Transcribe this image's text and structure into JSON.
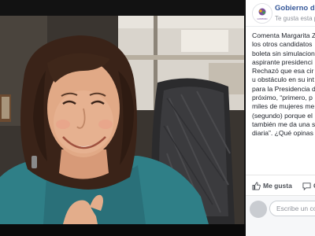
{
  "post": {
    "page_name": "Gobierno d",
    "page_meta": "Te gusta esta p",
    "logo_label": "GOBIERNO",
    "body_lines": [
      "Comenta Margarita Z",
      "los otros candidatos",
      "boleta sin simulacion",
      "aspirante presidenci",
      "Rechazó que esa cir",
      "u obstáculo en su int",
      "para la Presidencia d",
      "próximo, “primero, p",
      "miles de mujeres me",
      "(segundo) porque el",
      "también me da una s",
      "diaria”. ¿Qué opinas"
    ],
    "like_label": "Me gusta",
    "comment_label": "Co",
    "comment_placeholder": "Escribe un com"
  },
  "colors": {
    "link_blue": "#365899",
    "meta_gray": "#90949c",
    "text": "#1d2129",
    "backdrop": "#121212"
  },
  "icons": {
    "like": "thumbs-up-icon",
    "comment": "comment-bubble-icon"
  }
}
